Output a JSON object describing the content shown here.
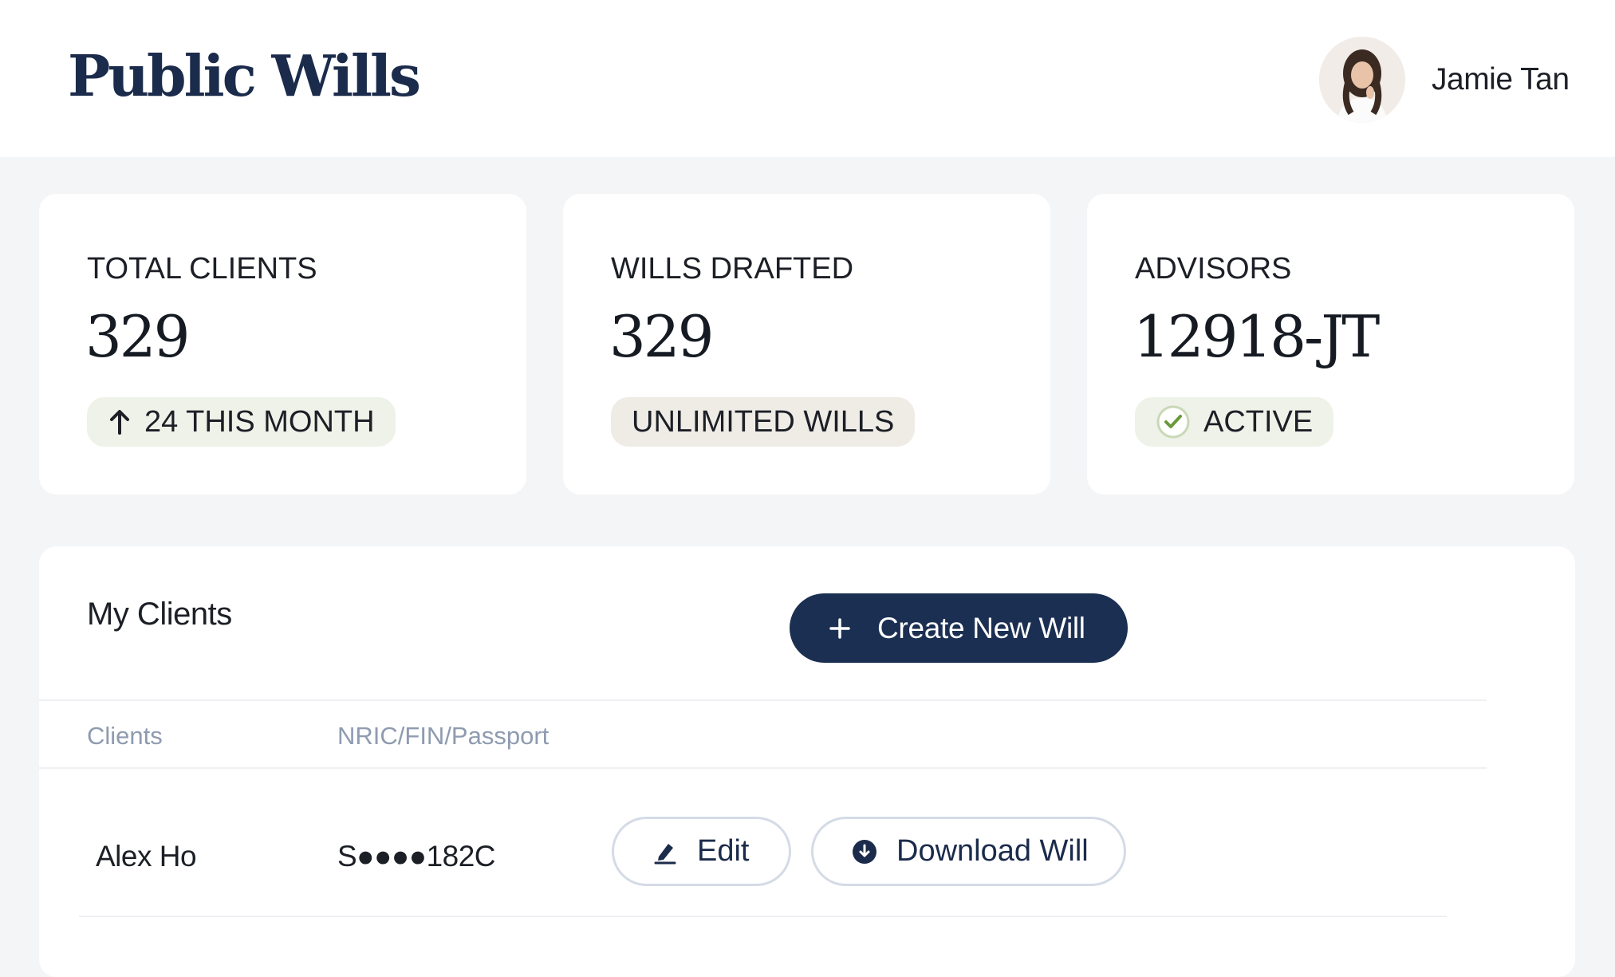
{
  "header": {
    "brand": "Public Wills",
    "user_name": "Jamie Tan",
    "avatar_icon": "user-avatar-photo"
  },
  "stats": [
    {
      "label": "TOTAL CLIENTS",
      "value": "329",
      "badge": "24 THIS MONTH",
      "badge_icon": "arrow-up-icon",
      "badge_color": "#eef2e8"
    },
    {
      "label": "WILLS DRAFTED",
      "value": "329",
      "badge": "UNLIMITED WILLS",
      "badge_color": "#efece6"
    },
    {
      "label": "ADVISORS",
      "value": "12918-JT",
      "badge": "ACTIVE",
      "badge_icon": "check-circle-icon",
      "badge_color": "#eef2e8"
    }
  ],
  "clients": {
    "title": "My Clients",
    "create_button": "Create New Will",
    "create_icon": "plus-icon",
    "columns": [
      "Clients",
      "NRIC/FIN/Passport"
    ],
    "rows": [
      {
        "name": "Alex Ho",
        "nric": "S●●●●182C",
        "edit_label": "Edit",
        "download_label": "Download Will"
      }
    ]
  },
  "colors": {
    "brand_navy": "#1b2b4b",
    "button_navy": "#1b2f52",
    "page_bg": "#f4f5f7",
    "muted_text": "#8e9bb0",
    "check_green": "#6a9a3a"
  }
}
